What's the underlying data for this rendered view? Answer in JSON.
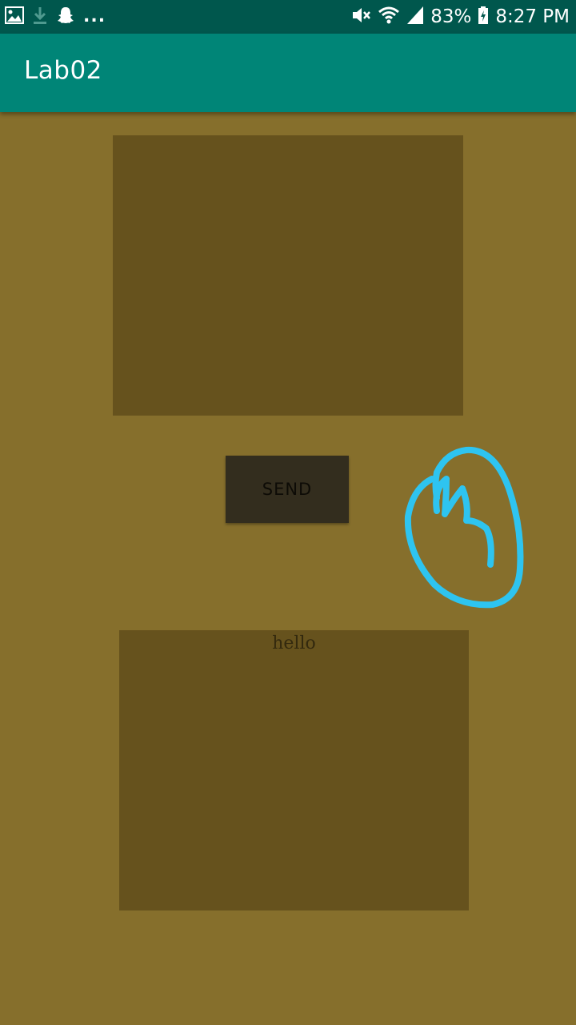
{
  "status_bar": {
    "left_icons": [
      "gallery-icon",
      "download-icon",
      "snapchat-icon"
    ],
    "overflow": "...",
    "right_icons": [
      "mute-icon",
      "wifi-icon",
      "signal-icon",
      "battery-charging-icon"
    ],
    "battery": "83%",
    "time": "8:27 PM",
    "background_color": "#00574d"
  },
  "app_bar": {
    "title": "Lab02",
    "background_color": "#008577"
  },
  "content": {
    "background_color": "#866f2c",
    "input_panel": {
      "text": ""
    },
    "send_button": {
      "label": "SEND"
    },
    "output_panel": {
      "text": "hello"
    },
    "annotation": {
      "icon": "hand-drawn-circle-arrow",
      "color": "#2ec4f0"
    }
  }
}
